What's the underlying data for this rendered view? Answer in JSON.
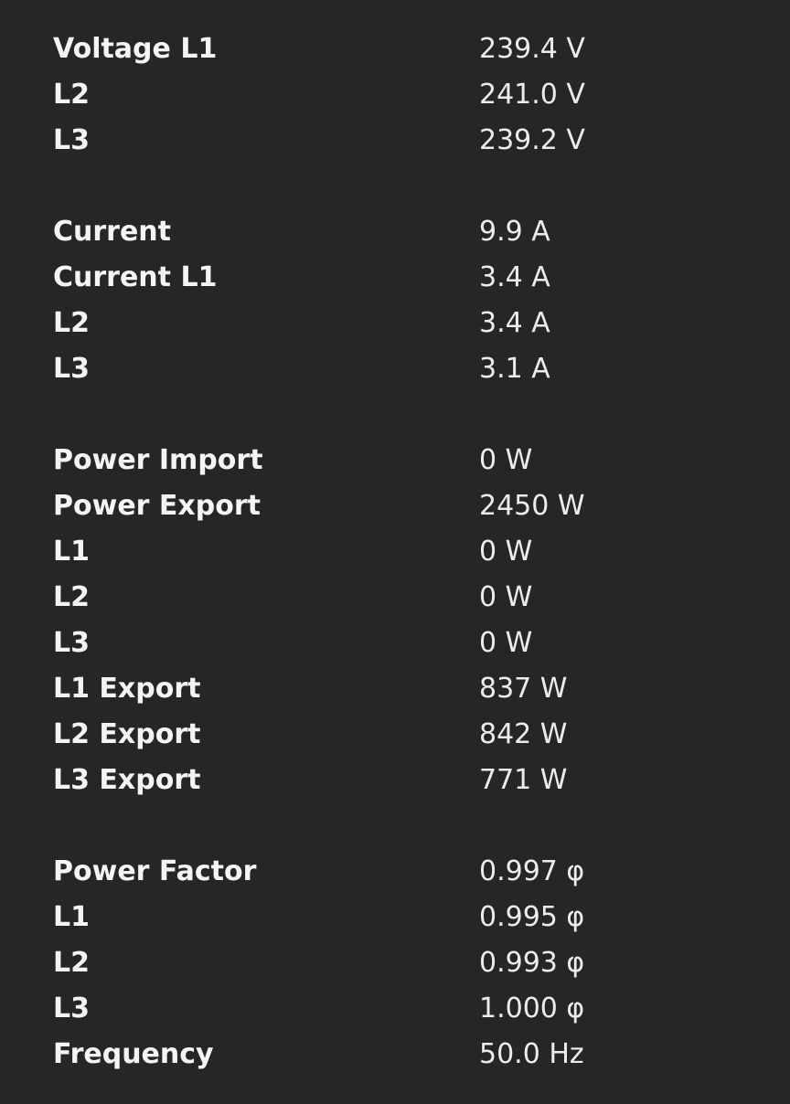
{
  "voltage": [
    {
      "label": "Voltage L1",
      "value": "239.4 V"
    },
    {
      "label": "L2",
      "value": "241.0 V"
    },
    {
      "label": "L3",
      "value": "239.2 V"
    }
  ],
  "current": [
    {
      "label": "Current",
      "value": "9.9 A"
    },
    {
      "label": "Current L1",
      "value": "3.4 A"
    },
    {
      "label": "L2",
      "value": "3.4 A"
    },
    {
      "label": "L3",
      "value": "3.1 A"
    }
  ],
  "power": [
    {
      "label": "Power Import",
      "value": "0 W"
    },
    {
      "label": "Power Export",
      "value": "2450 W"
    },
    {
      "label": "L1",
      "value": "0 W"
    },
    {
      "label": "L2",
      "value": "0 W"
    },
    {
      "label": "L3",
      "value": "0 W"
    },
    {
      "label": "L1 Export",
      "value": "837 W"
    },
    {
      "label": "L2 Export",
      "value": "842 W"
    },
    {
      "label": "L3 Export",
      "value": "771 W"
    }
  ],
  "power_factor": [
    {
      "label": "Power Factor",
      "value": "0.997 φ"
    },
    {
      "label": "L1",
      "value": "0.995 φ"
    },
    {
      "label": "L2",
      "value": "0.993 φ"
    },
    {
      "label": "L3",
      "value": "1.000 φ"
    },
    {
      "label": "Frequency",
      "value": "50.0 Hz"
    }
  ]
}
